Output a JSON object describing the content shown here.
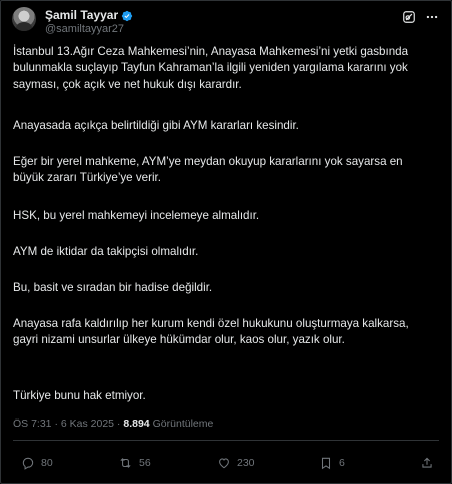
{
  "author": {
    "name": "Şamil Tayyar",
    "handle": "@samiltayyar27"
  },
  "tweet": {
    "paragraphs": [
      "İstanbul 13.Ağır Ceza Mahkemesi’nin, Anayasa Mahkemesi’ni yetki gasbında bulunmakla suçlayıp Tayfun Kahraman’la ilgili yeniden yargılama kararını yok sayması, çok açık ve net hukuk dışı karardır.",
      "Anayasada açıkça belirtildiği gibi AYM kararları kesindir.",
      "Eğer bir yerel mahkeme, AYM’ye meydan okuyup kararlarını yok sayarsa en büyük zararı Türkiye’ye verir.",
      "HSK, bu yerel mahkemeyi incelemeye almalıdır.",
      "AYM de iktidar da takipçisi olmalıdır.",
      "Bu, basit ve sıradan bir hadise değildir.",
      "Anayasa rafa kaldırılıp her kurum kendi özel hukukunu oluşturmaya kalkarsa, gayri nizami unsurlar ülkeye hükümdar olur, kaos olur, yazık olur.",
      "Türkiye bunu hak etmiyor."
    ]
  },
  "meta": {
    "time": "ÖS 7:31",
    "sep1": " · ",
    "date": "6 Kas 2025",
    "sep2": " · ",
    "views": "8.894",
    "views_label": "Görüntüleme"
  },
  "actions": {
    "replies": "80",
    "reposts": "56",
    "likes": "230",
    "bookmarks": "6"
  },
  "colors": {
    "background": "#000000",
    "text": "#e7e9ea",
    "secondary": "#71767b",
    "verified": "#1d9bf0",
    "border": "#2f3336"
  },
  "icons": [
    "verified-badge-icon",
    "grok-icon",
    "more-icon",
    "reply-icon",
    "repost-icon",
    "like-icon",
    "bookmark-icon",
    "share-icon"
  ]
}
